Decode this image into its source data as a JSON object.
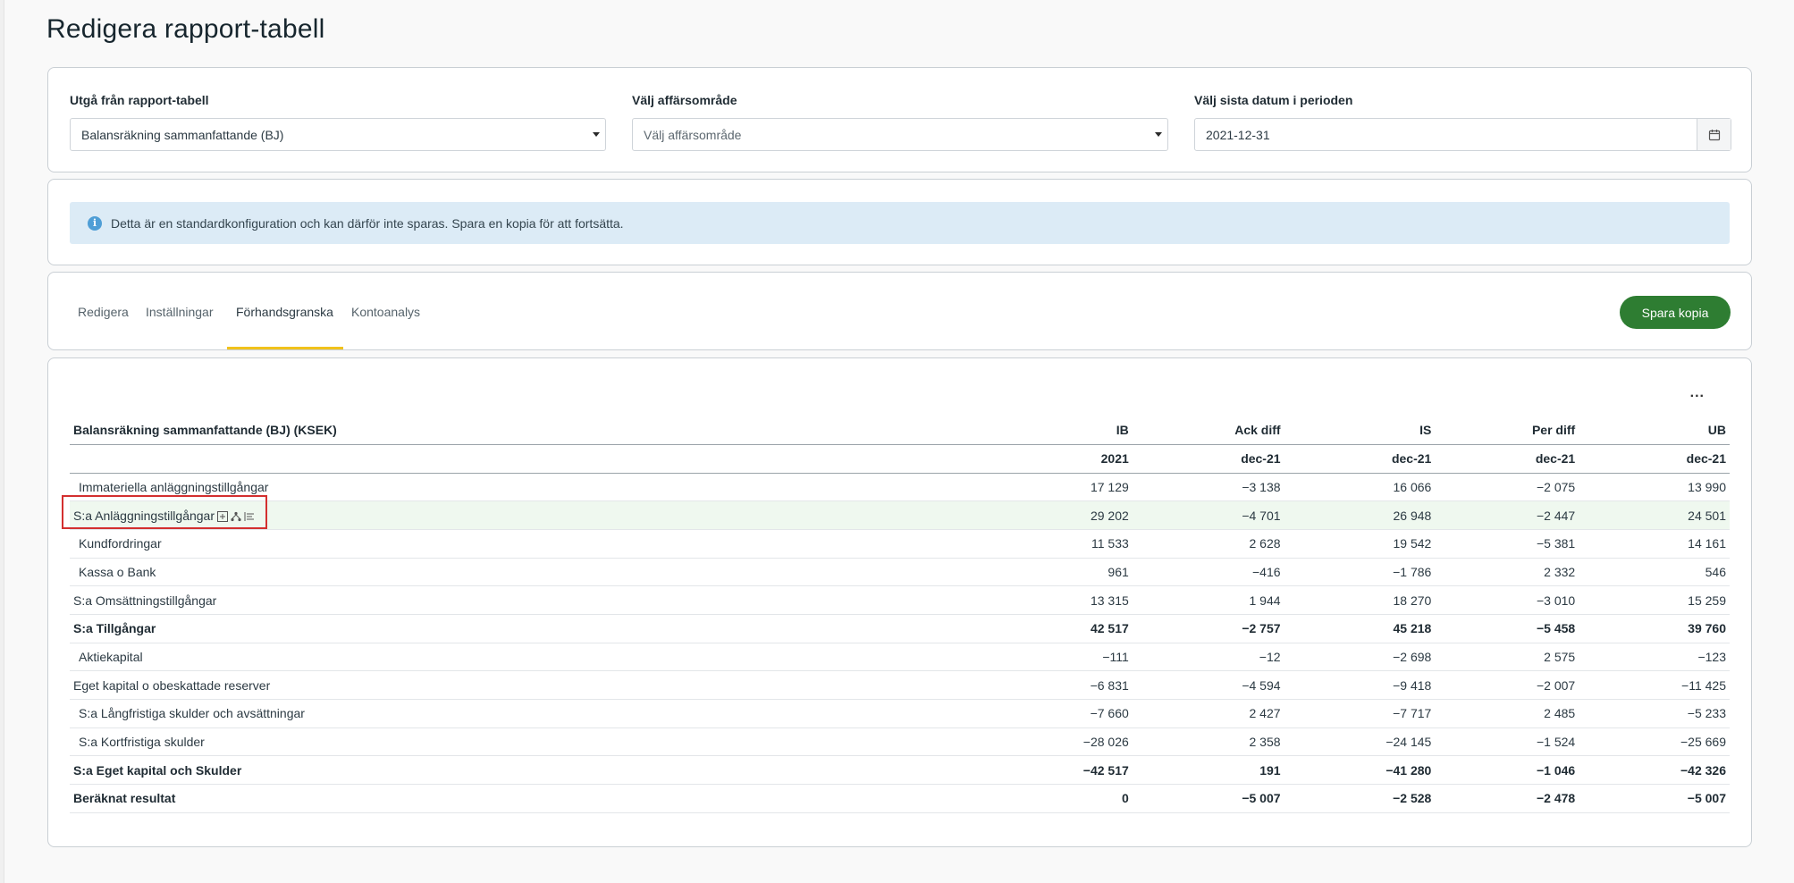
{
  "page": {
    "title": "Redigera rapport-tabell"
  },
  "filters": {
    "report_table": {
      "label": "Utgå från rapport-tabell",
      "value": "Balansräkning sammanfattande (BJ)"
    },
    "business_area": {
      "label": "Välj affärsområde",
      "placeholder": "Välj affärsområde"
    },
    "last_date": {
      "label": "Välj sista datum i perioden",
      "value": "2021-12-31",
      "icon": "calendar-icon"
    }
  },
  "alert": {
    "icon": "info-icon",
    "text": "Detta är en standardkonfiguration och kan därför inte sparas. Spara en kopia för att fortsätta."
  },
  "tabs": {
    "items": [
      {
        "label": "Redigera"
      },
      {
        "label": "Inställningar"
      },
      {
        "label": "Förhandsgranska"
      },
      {
        "label": "Kontoanalys"
      }
    ],
    "active": "Förhandsgranska",
    "save_copy_label": "Spara kopia",
    "accent": "#2e7d32",
    "tab_accent": "#f1c21b"
  },
  "table": {
    "more_label": "...",
    "columns": [
      "Balansräkning sammanfattande (BJ) (KSEK)",
      "IB",
      "Ack diff",
      "IS",
      "Per diff",
      "UB"
    ],
    "subheaders": [
      "",
      "2021",
      "dec-21",
      "dec-21",
      "dec-21",
      "dec-21"
    ],
    "rows": [
      {
        "label": "Immateriella anläggningstillgångar",
        "values": [
          "17 129",
          "−3 138",
          "16 066",
          "−2 075",
          "13 990"
        ]
      },
      {
        "label": "S:a Anläggningstillgångar",
        "values": [
          "29 202",
          "−4 701",
          "26 948",
          "−2 447",
          "24 501"
        ]
      },
      {
        "label": "Kundfordringar",
        "values": [
          "11 533",
          "2 628",
          "19 542",
          "−5 381",
          "14 161"
        ]
      },
      {
        "label": "Kassa o Bank",
        "values": [
          "961",
          "−416",
          "−1 786",
          "2 332",
          "546"
        ]
      },
      {
        "label": "S:a Omsättningstillgångar",
        "values": [
          "13 315",
          "1 944",
          "18 270",
          "−3 010",
          "15 259"
        ]
      },
      {
        "label": "S:a Tillgångar",
        "values": [
          "42 517",
          "−2 757",
          "45 218",
          "−5 458",
          "39 760"
        ]
      },
      {
        "label": "Aktiekapital",
        "values": [
          "−111",
          "−12",
          "−2 698",
          "2 575",
          "−123"
        ]
      },
      {
        "label": "Eget kapital o obeskattade reserver",
        "values": [
          "−6 831",
          "−4 594",
          "−9 418",
          "−2 007",
          "−11 425"
        ]
      },
      {
        "label": "S:a Långfristiga skulder och avsättningar",
        "values": [
          "−7 660",
          "2 427",
          "−7 717",
          "2 485",
          "−5 233"
        ]
      },
      {
        "label": "S:a Kortfristiga skulder",
        "values": [
          "−28 026",
          "2 358",
          "−24 145",
          "−1 524",
          "−25 669"
        ]
      },
      {
        "label": "S:a Eget kapital och Skulder",
        "values": [
          "−42 517",
          "191",
          "−41 280",
          "−1 046",
          "−42 326"
        ]
      },
      {
        "label": "Beräknat resultat",
        "values": [
          "0",
          "−5 007",
          "−2 528",
          "−2 478",
          "−5 007"
        ]
      }
    ],
    "row_tool_icons": [
      "add-row-icon",
      "hierarchy-icon",
      "list-icon"
    ]
  }
}
